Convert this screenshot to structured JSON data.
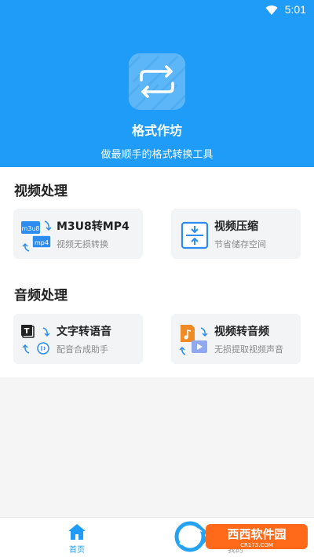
{
  "status_bar": {
    "time": "5:01"
  },
  "app": {
    "name": "格式作坊",
    "slogan": "做最顺手的格式转换工具",
    "accent": "#1e9cf7"
  },
  "sections": [
    {
      "title": "视频处理",
      "cards": [
        {
          "title": "M3U8转MP4",
          "subtitle": "视频无损转换",
          "icon": "m3u8-to-mp4-icon",
          "icon_labels": [
            "m3u8",
            "mp4"
          ]
        },
        {
          "title": "视频压缩",
          "subtitle": "节省储存空间",
          "icon": "compress-icon"
        }
      ]
    },
    {
      "title": "音频处理",
      "cards": [
        {
          "title": "文字转语音",
          "subtitle": "配音合成助手",
          "icon": "text-to-speech-icon",
          "icon_labels": [
            "T"
          ]
        },
        {
          "title": "视频转音频",
          "subtitle": "无损提取视频声音",
          "icon": "video-to-audio-icon"
        }
      ]
    }
  ],
  "tabbar": {
    "tabs": [
      {
        "label": "首页",
        "active": true,
        "icon": "home-icon"
      },
      {
        "label": "我的",
        "active": false,
        "icon": "profile-icon"
      }
    ]
  },
  "watermark": {
    "text": "西西软件园",
    "url": "CR173.COM"
  }
}
